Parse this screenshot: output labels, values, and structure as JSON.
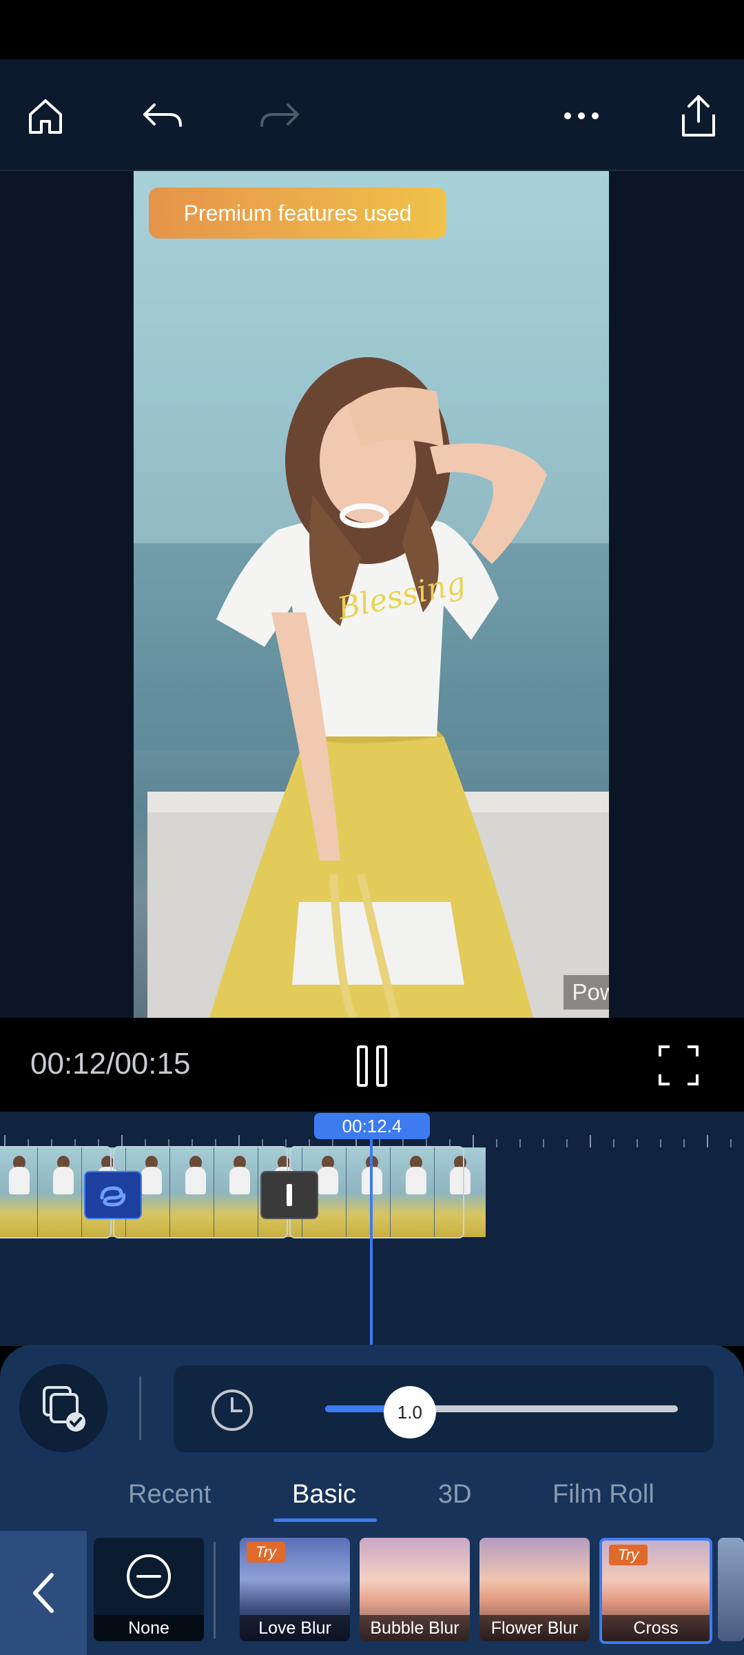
{
  "toolbar": {
    "icons": [
      "home-icon",
      "undo-icon",
      "redo-icon",
      "more-icon",
      "share-icon"
    ]
  },
  "preview": {
    "badge": "Premium features used",
    "watermark": "PowerDirector"
  },
  "playback": {
    "timecode": "00:12/00:15",
    "state": "playing"
  },
  "timeline": {
    "playhead_time": "00:12.4"
  },
  "panel": {
    "speed_value": "1.0",
    "speed_fraction": 0.24,
    "tabs": [
      "Recent",
      "Basic",
      "3D",
      "Film Roll"
    ],
    "active_tab": "Basic",
    "effects": [
      {
        "label": "None"
      },
      {
        "label": "Love Blur",
        "try": "Try"
      },
      {
        "label": "Bubble Blur"
      },
      {
        "label": "Flower Blur"
      },
      {
        "label": "Cross",
        "try": "Try"
      }
    ]
  },
  "colors": {
    "accent": "#3d7bf0",
    "toolbar_bg": "#0d1a2e",
    "panel_bg": "#17335a",
    "badge_start": "#e6944a",
    "badge_end": "#f0c24a"
  }
}
